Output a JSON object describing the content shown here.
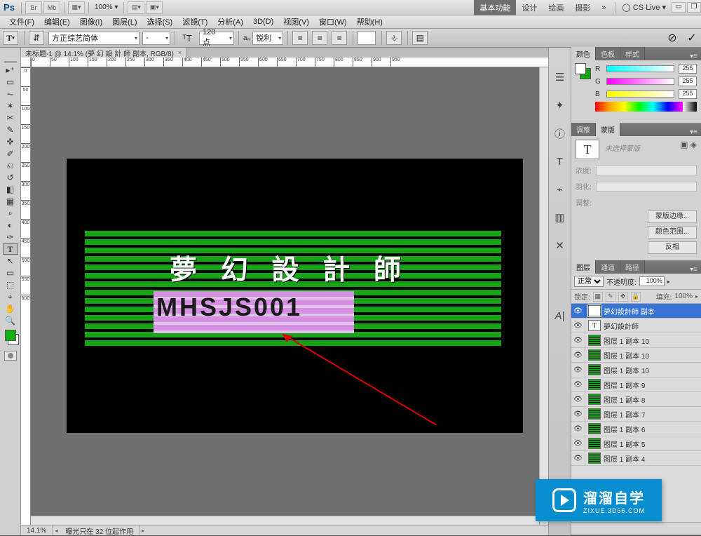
{
  "app": {
    "logo": "Ps",
    "zoom_label": "100%"
  },
  "workspace_tabs": {
    "active": "基本功能",
    "t1": "设计",
    "t2": "绘画",
    "t3": "摄影",
    "more": "»",
    "cslive": "CS Live"
  },
  "menu": {
    "file": "文件(F)",
    "edit": "编辑(E)",
    "image": "图像(I)",
    "layer": "图层(L)",
    "select": "选择(S)",
    "filter": "滤镜(T)",
    "analysis": "分析(A)",
    "threeD": "3D(D)",
    "view": "视图(V)",
    "window": "窗口(W)",
    "help": "帮助(H)"
  },
  "options": {
    "font_family": "方正综艺简体",
    "font_style": "-",
    "size_value": "120 点",
    "aa_prefix": "aₐ",
    "aa": "锐利",
    "color": "#ffffff"
  },
  "document": {
    "tab_title": "未标题-1 @ 14.1% (夢 幻 設 計 師 副本, RGB/8)",
    "heading": "夢 幻 設 計 師",
    "subtext": "MHSJS001"
  },
  "status": {
    "zoom": "14.1%",
    "info": "曝光只在 32 位起作用"
  },
  "color_panel": {
    "tab_color": "颜色",
    "tab_swatches": "色板",
    "tab_styles": "样式",
    "r_label": "R",
    "g_label": "G",
    "b_label": "B",
    "r": "255",
    "g": "255",
    "b": "255"
  },
  "mask_panel": {
    "tab_adjust": "调整",
    "tab_mask": "蒙版",
    "none_label": "未选择蒙版",
    "density_label": "浓度:",
    "feather_label": "羽化:",
    "adjust_label": "调整:",
    "btn_edge": "蒙版边缘...",
    "btn_range": "颜色范围...",
    "btn_invert": "反相"
  },
  "layers_panel": {
    "tab_layers": "图层",
    "tab_channels": "通道",
    "tab_paths": "路径",
    "blend_mode": "正常",
    "opacity_label": "不透明度:",
    "opacity": "100%",
    "lock_label": "锁定:",
    "fill_label": "填充:",
    "fill": "100%",
    "items": [
      {
        "name": "夢幻設計師 副本",
        "type": "T",
        "sel": true
      },
      {
        "name": "夢幻設計師",
        "type": "T",
        "sel": false
      },
      {
        "name": "图层 1 副本 10",
        "type": "img",
        "sel": false
      },
      {
        "name": "图层 1 副本 10",
        "type": "img",
        "sel": false
      },
      {
        "name": "图层 1 副本 10",
        "type": "img",
        "sel": false
      },
      {
        "name": "图层 1 副本 9",
        "type": "img",
        "sel": false
      },
      {
        "name": "图层 1 副本 8",
        "type": "img",
        "sel": false
      },
      {
        "name": "图层 1 副本 7",
        "type": "img",
        "sel": false
      },
      {
        "name": "图层 1 副本 6",
        "type": "img",
        "sel": false
      },
      {
        "name": "图层 1 副本 5",
        "type": "img",
        "sel": false
      },
      {
        "name": "图层 1 副本 4",
        "type": "img",
        "sel": false
      }
    ]
  },
  "watermark": {
    "title": "溜溜自学",
    "url": "ZIXUE.3D66.COM"
  },
  "ruler_h": [
    "0",
    "50",
    "100",
    "150",
    "200",
    "250",
    "300",
    "350",
    "400",
    "450",
    "500",
    "550",
    "600",
    "650",
    "700",
    "750",
    "800",
    "850",
    "900",
    "950"
  ],
  "ruler_v": [
    "0",
    "50",
    "100",
    "150",
    "200",
    "250",
    "300",
    "350",
    "400",
    "450",
    "500",
    "550",
    "600"
  ]
}
